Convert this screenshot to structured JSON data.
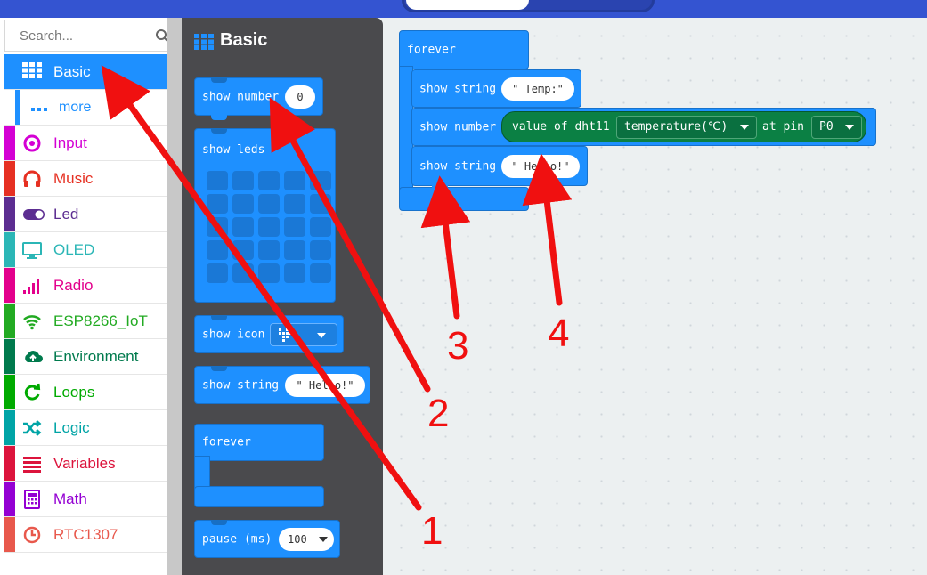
{
  "toolbox": {
    "search_placeholder": "Search...",
    "categories": [
      {
        "label": "Basic",
        "color": "#1e90ff",
        "icon": "grid-icon"
      },
      {
        "label": "more",
        "color": "#1e90ff",
        "icon": "dots-icon"
      },
      {
        "label": "Input",
        "color": "#d400d4",
        "icon": "target-icon"
      },
      {
        "label": "Music",
        "color": "#e63022",
        "icon": "headphones-icon"
      },
      {
        "label": "Led",
        "color": "#5c2d91",
        "icon": "toggle-icon"
      },
      {
        "label": "OLED",
        "color": "#2bb6b6",
        "icon": "monitor-icon"
      },
      {
        "label": "Radio",
        "color": "#e3008c",
        "icon": "signal-bars-icon"
      },
      {
        "label": "ESP8266_IoT",
        "color": "#22aa22",
        "icon": "wifi-icon"
      },
      {
        "label": "Environment",
        "color": "#007a4d",
        "icon": "cloud-upload-icon"
      },
      {
        "label": "Loops",
        "color": "#00aa00",
        "icon": "refresh-icon"
      },
      {
        "label": "Logic",
        "color": "#00a4a6",
        "icon": "shuffle-icon"
      },
      {
        "label": "Variables",
        "color": "#dc143c",
        "icon": "list-icon"
      },
      {
        "label": "Math",
        "color": "#9400d3",
        "icon": "calculator-icon"
      },
      {
        "label": "RTC1307",
        "color": "#e8584c",
        "icon": "clock-icon"
      }
    ]
  },
  "flyout": {
    "title": "Basic",
    "show_number": {
      "label": "show number",
      "value": "0"
    },
    "show_leds": {
      "label": "show leds"
    },
    "show_icon": {
      "label": "show icon"
    },
    "show_string": {
      "label": "show string",
      "value": "\" Hello!\""
    },
    "forever": {
      "label": "forever"
    },
    "pause": {
      "label": "pause (ms)",
      "value": "100"
    }
  },
  "workspace": {
    "forever_label": "forever",
    "show_string_1": {
      "label": "show string",
      "value": "\" Temp:\""
    },
    "show_number": {
      "label": "show number",
      "reporter_label": "value of dht11",
      "dropdown_value": "temperature(℃)",
      "at_pin_label": "at pin",
      "pin_value": "P0"
    },
    "show_string_2": {
      "label": "show string",
      "value": "\" Hello!\""
    }
  },
  "annotations": {
    "color": "#f01010",
    "labels": [
      "1",
      "2",
      "3",
      "4"
    ]
  }
}
